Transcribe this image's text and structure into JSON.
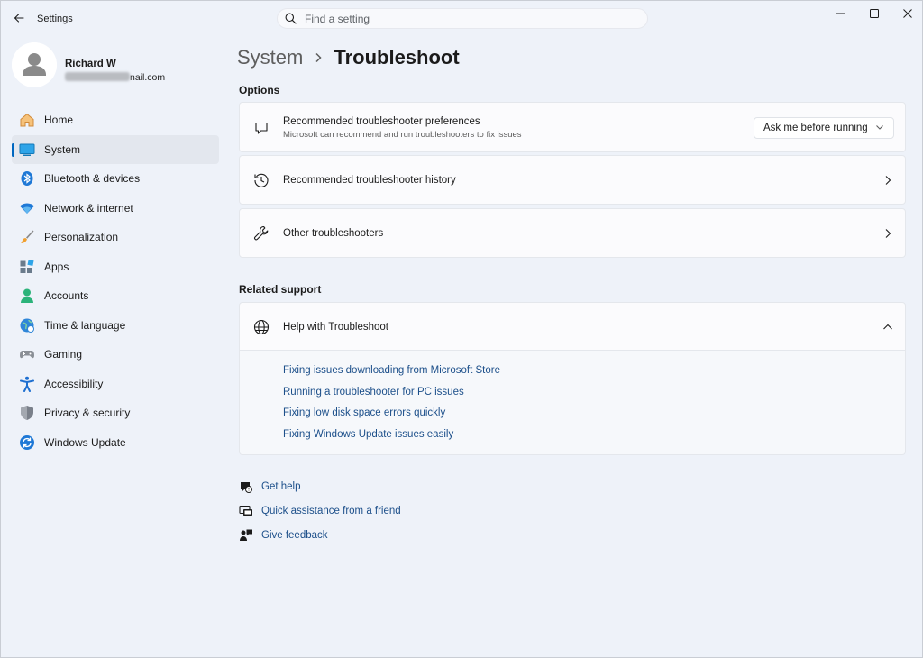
{
  "window": {
    "title": "Settings",
    "controls": {
      "minimize": "—",
      "maximize": "☐",
      "close": "✕"
    }
  },
  "search": {
    "placeholder": "Find a setting",
    "value": ""
  },
  "profile": {
    "name": "Richard W",
    "email_visible": "nail.com"
  },
  "sidebar": {
    "items": [
      {
        "label": "Home",
        "icon": "home-icon"
      },
      {
        "label": "System",
        "icon": "system-icon",
        "selected": true
      },
      {
        "label": "Bluetooth & devices",
        "icon": "bluetooth-icon"
      },
      {
        "label": "Network & internet",
        "icon": "network-icon"
      },
      {
        "label": "Personalization",
        "icon": "brush-icon"
      },
      {
        "label": "Apps",
        "icon": "apps-icon"
      },
      {
        "label": "Accounts",
        "icon": "accounts-icon"
      },
      {
        "label": "Time & language",
        "icon": "time-language-icon"
      },
      {
        "label": "Gaming",
        "icon": "gamepad-icon"
      },
      {
        "label": "Accessibility",
        "icon": "accessibility-icon"
      },
      {
        "label": "Privacy & security",
        "icon": "shield-icon"
      },
      {
        "label": "Windows Update",
        "icon": "update-icon"
      }
    ]
  },
  "breadcrumb": {
    "parent": "System",
    "separator": "›",
    "current": "Troubleshoot"
  },
  "options": {
    "heading": "Options",
    "preferences": {
      "title": "Recommended troubleshooter preferences",
      "subtitle": "Microsoft can recommend and run troubleshooters to fix issues",
      "dropdown_value": "Ask me before running"
    },
    "history": {
      "title": "Recommended troubleshooter history"
    },
    "other": {
      "title": "Other troubleshooters"
    }
  },
  "related": {
    "heading": "Related support",
    "help": {
      "title": "Help with Troubleshoot",
      "links": [
        "Fixing issues downloading from Microsoft Store",
        "Running a troubleshooter for PC issues",
        "Fixing low disk space errors quickly",
        "Fixing Windows Update issues easily"
      ]
    }
  },
  "footer": {
    "get_help": "Get help",
    "quick_assist": "Quick assistance from a friend",
    "feedback": "Give feedback"
  },
  "colors": {
    "accent": "#0067c0",
    "link": "#1c4f8a",
    "background": "#eef2f9",
    "card": "#fbfbfd"
  }
}
